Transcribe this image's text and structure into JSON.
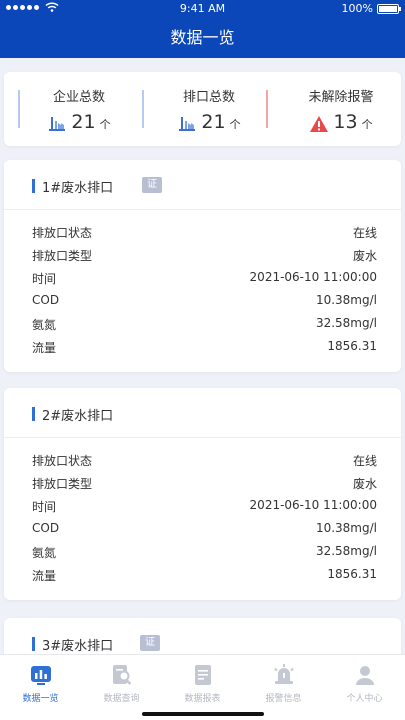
{
  "statusbar": {
    "time": "9:41 AM",
    "battery": "100%"
  },
  "nav": {
    "title": "数据一览"
  },
  "summary": {
    "enterprise": {
      "label": "企业总数",
      "value": "21",
      "unit": "个"
    },
    "outlet": {
      "label": "排口总数",
      "value": "21",
      "unit": "个"
    },
    "alarm": {
      "label": "未解除报警",
      "value": "13",
      "unit": "个"
    }
  },
  "cards": [
    {
      "title": "1#废水排口",
      "badge": "证",
      "rows": [
        {
          "k": "排放口状态",
          "v": "在线"
        },
        {
          "k": "排放口类型",
          "v": "废水"
        },
        {
          "k": "时间",
          "v": "2021-06-10 11:00:00"
        },
        {
          "k": "COD",
          "v": "10.38mg/l"
        },
        {
          "k": "氨氮",
          "v": "32.58mg/l"
        },
        {
          "k": "流量",
          "v": "1856.31"
        }
      ]
    },
    {
      "title": "2#废水排口",
      "badge": "",
      "rows": [
        {
          "k": "排放口状态",
          "v": "在线"
        },
        {
          "k": "排放口类型",
          "v": "废水"
        },
        {
          "k": "时间",
          "v": "2021-06-10 11:00:00"
        },
        {
          "k": "COD",
          "v": "10.38mg/l"
        },
        {
          "k": "氨氮",
          "v": "32.58mg/l"
        },
        {
          "k": "流量",
          "v": "1856.31"
        }
      ]
    },
    {
      "title": "3#废水排口",
      "badge": "证",
      "rows": []
    }
  ],
  "tabs": [
    {
      "label": "数据一览",
      "icon": "chart-icon",
      "active": true
    },
    {
      "label": "数据查询",
      "icon": "search-doc-icon",
      "active": false
    },
    {
      "label": "数据报表",
      "icon": "report-icon",
      "active": false
    },
    {
      "label": "报警信息",
      "icon": "alarm-icon",
      "active": false
    },
    {
      "label": "个人中心",
      "icon": "user-icon",
      "active": false
    }
  ],
  "colors": {
    "primary": "#0b47b8",
    "accent": "#2f6fd6",
    "alarm": "#e8494b",
    "divider_blue": "#b7c9ef",
    "divider_red": "#f3a7a5"
  }
}
